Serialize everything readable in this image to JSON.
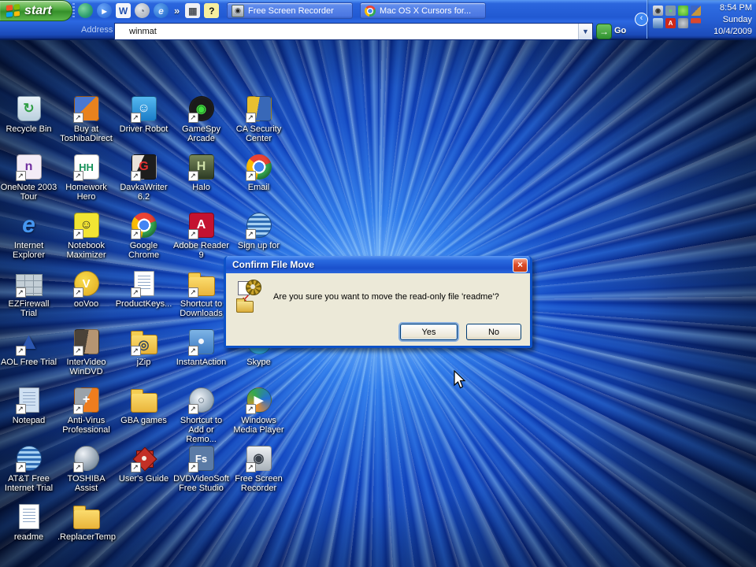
{
  "colors": {
    "taskbar_blue": "#2159d2",
    "taskbar_edge": "#061f5e",
    "start_green": "#358f2a",
    "dialog_bg": "#ece9d8",
    "title_blue": "#1a50cc",
    "close_red": "#dd4b28",
    "folder_yellow": "#f2c94c",
    "label_text": "#ffffff",
    "chrome_ball": [
      "#ea4335",
      "#34a853",
      "#fbbc05",
      "#4285f4"
    ]
  },
  "taskbar": {
    "start": {
      "label": "start"
    },
    "quick_launch": [
      {
        "name": "msn-quicklaunch-icon",
        "shape": "round",
        "glyph": "",
        "fg": "#ffffff",
        "bg": "radial-gradient(circle at 35% 35%, #7ed6a0, #2e9e6e 60%, #1c6e8e)"
      },
      {
        "name": "media-player-quicklaunch-icon",
        "shape": "round",
        "glyph": "▸",
        "fg": "#ffffff",
        "bg": "radial-gradient(circle at 35% 35%, #6aa6f8, #1e5ed0)"
      },
      {
        "name": "word-quicklaunch-icon",
        "shape": "square",
        "glyph": "W",
        "fg": "#1f4fae",
        "bg": "#f4f6fa"
      },
      {
        "name": "quicktime-quicklaunch-icon",
        "shape": "round",
        "glyph": "◔",
        "fg": "#6a7280",
        "bg": "radial-gradient(circle at 35% 35%, #e4e8ee, #9aa2ae)"
      },
      {
        "name": "internet-explorer-quicklaunch-icon",
        "shape": "round",
        "glyph": "e",
        "fg": "#eaf2ff",
        "bg": "radial-gradient(circle at 35% 35%, #63a6f0, #1b62c8)"
      }
    ],
    "overflow_chevron": "»",
    "extra_icons": [
      {
        "name": "keyboard-icon",
        "shape": "square",
        "glyph": "▦",
        "fg": "#4a5058",
        "bg": "#eef0f4"
      },
      {
        "name": "help-icon",
        "shape": "square",
        "glyph": "?",
        "fg": "#111111",
        "bg": "#f7ef9e"
      },
      {
        "name": "desktop-toolbar-icon",
        "shape": "square",
        "glyph": "▣",
        "fg": "#eaf2ff",
        "bg": "transparent"
      },
      {
        "name": "toolbar-dropdown-icon",
        "shape": "square",
        "glyph": "▾",
        "fg": "#eaf2ff",
        "bg": "transparent"
      }
    ],
    "window_buttons": [
      {
        "label": "Free Screen Recorder",
        "icon_name": "camera-icon",
        "icon_class": "cam",
        "icon_glyph": "◉"
      },
      {
        "label": "Mac OS X Cursors for...",
        "icon_name": "chrome-icon",
        "icon_class": "chr",
        "icon_glyph": ""
      }
    ],
    "address": {
      "label": "Address",
      "value": "winmat",
      "dropdown_glyph": "▼",
      "go_label": "Go",
      "go_glyph": "→"
    },
    "tray": {
      "hidden_chevron": "‹",
      "icons": [
        {
          "name": "camera-tray-icon",
          "bg": "linear-gradient(#dfe3e8,#9aa2aa)",
          "glyph": "◉",
          "fg": "#333333"
        },
        {
          "name": "network-monitor-tray-icon",
          "bg": "#7e96ac",
          "glyph": "»",
          "fg": "#58e858"
        },
        {
          "name": "antivirus-shield-tray-icon",
          "bg": "radial-gradient(#9fe35f,#3fae2a)",
          "glyph": "",
          "fg": "#ffffff"
        },
        {
          "name": "security-shield-tray-icon",
          "bg": "linear-gradient(135deg,#3b64c4 50%,#c8963c 50%)",
          "glyph": "",
          "fg": "#ffffff"
        },
        {
          "name": "computer-tray-icon",
          "bg": "linear-gradient(#bcd6f0,#4a7ab8)",
          "glyph": "",
          "fg": "#ffffff"
        },
        {
          "name": "ati-tray-icon",
          "bg": "#d02818",
          "glyph": "A",
          "fg": "#ffffff"
        },
        {
          "name": "volume-tray-icon",
          "bg": "radial-gradient(#c8cdd4,#7e858e)",
          "glyph": "",
          "fg": "#333333"
        },
        {
          "name": "battery-tray-icon",
          "bg": "linear-gradient(#d84830 50%,#2858c0 50%)",
          "glyph": "",
          "fg": "#ffffff"
        }
      ],
      "time": "8:54 PM",
      "day": "Sunday",
      "date": "10/4/2009"
    }
  },
  "dialog": {
    "title": "Confirm File Move",
    "close_glyph": "×",
    "message": "Are you sure you want to move the read-only file 'readme'?",
    "yes_label": "Yes",
    "no_label": "No"
  },
  "desktop": {
    "icons": [
      {
        "label": "Recycle Bin",
        "name": "recycle-bin",
        "type": "bin",
        "bg": "linear-gradient(#eaf3f9,#b9cfdd)",
        "glyph": "↻",
        "fg": "#2f9e44",
        "col": 0,
        "row": 0,
        "shortcut": false
      },
      {
        "label": "Buy at ToshibaDirect",
        "name": "buy-at-toshibadirect",
        "type": "square",
        "bg": "linear-gradient(135deg,#4a78d0 45%,#e8821e 45%)",
        "glyph": "",
        "fg": "#ffffff",
        "col": 1,
        "row": 0,
        "shortcut": true
      },
      {
        "label": "Driver Robot",
        "name": "driver-robot",
        "type": "square",
        "bg": "linear-gradient(#55b8f0,#1a7cc8)",
        "glyph": "☺",
        "fg": "#ffffff",
        "col": 2,
        "row": 0,
        "shortcut": true
      },
      {
        "label": "GameSpy Arcade",
        "name": "gamespy-arcade",
        "type": "circle",
        "bg": "radial-gradient(#1a1a1a 60%,#303030)",
        "glyph": "◉",
        "fg": "#3fe03f",
        "col": 3,
        "row": 0,
        "shortcut": true
      },
      {
        "label": "CA Security Center",
        "name": "ca-security-center",
        "type": "square",
        "bg": "linear-gradient(100deg,#e8c030 45%,#3868b8 45%)",
        "glyph": "",
        "fg": "#ffffff",
        "col": 4,
        "row": 0,
        "shortcut": true
      },
      {
        "label": "OneNote 2003 Tour",
        "name": "onenote-2003-tour",
        "type": "square",
        "bg": "#f3ecf7",
        "glyph": "n",
        "fg": "#7030a0",
        "col": 0,
        "row": 1,
        "shortcut": true
      },
      {
        "label": "Homework Hero",
        "name": "homework-hero",
        "type": "square",
        "bg": "#ffffff",
        "glyph": "HH",
        "fg": "#17925a",
        "col": 1,
        "row": 1,
        "shortcut": true
      },
      {
        "label": "DavkaWriter 6.2",
        "name": "davkawriter-62",
        "type": "square",
        "bg": "linear-gradient(115deg,#e9e2da 35%,#1d1d1d 35%)",
        "glyph": "G",
        "fg": "#e03030",
        "col": 2,
        "row": 1,
        "shortcut": true
      },
      {
        "label": "Halo",
        "name": "halo",
        "type": "square",
        "bg": "linear-gradient(#76875a,#2c3a24)",
        "glyph": "H",
        "fg": "#cfe0a8",
        "col": 3,
        "row": 1,
        "shortcut": true
      },
      {
        "label": "Email",
        "name": "email",
        "type": "chrome",
        "glyph": "",
        "fg": "",
        "col": 4,
        "row": 1,
        "shortcut": true
      },
      {
        "label": "Internet Explorer",
        "name": "internet-explorer",
        "type": "plain",
        "glyph": "e",
        "fg": "#4596f0",
        "col": 0,
        "row": 2,
        "shortcut": false
      },
      {
        "label": "Notebook Maximizer",
        "name": "notebook-maximizer",
        "type": "square",
        "bg": "#f2e533",
        "glyph": "☺",
        "fg": "#222222",
        "col": 1,
        "row": 2,
        "shortcut": true
      },
      {
        "label": "Google Chrome",
        "name": "google-chrome",
        "type": "chrome",
        "glyph": "",
        "fg": "",
        "col": 2,
        "row": 2,
        "shortcut": true
      },
      {
        "label": "Adobe Reader 9",
        "name": "adobe-reader-9",
        "type": "square",
        "bg": "#c41230",
        "glyph": "A",
        "fg": "#ffffff",
        "col": 3,
        "row": 2,
        "shortcut": true
      },
      {
        "label": "Sign up for",
        "name": "sign-up-for",
        "type": "globe",
        "glyph": "",
        "fg": "",
        "col": 4,
        "row": 2,
        "shortcut": true
      },
      {
        "label": "EZFirewall Trial",
        "name": "ezfirewall-trial",
        "type": "wall",
        "glyph": "",
        "fg": "",
        "col": 0,
        "row": 3,
        "shortcut": true
      },
      {
        "label": "ooVoo",
        "name": "oovoo",
        "type": "circle",
        "bg": "radial-gradient(circle at 40% 35%,#f9dc4e,#e0a81c)",
        "glyph": "V",
        "fg": "#ffffff",
        "col": 1,
        "row": 3,
        "shortcut": true
      },
      {
        "label": "ProductKeys...",
        "name": "productkeys",
        "type": "doc",
        "glyph": "",
        "fg": "",
        "col": 2,
        "row": 3,
        "shortcut": true
      },
      {
        "label": "Shortcut to Downloads",
        "name": "shortcut-to-downloads",
        "type": "folder",
        "glyph": "",
        "fg": "",
        "col": 3,
        "row": 3,
        "shortcut": true
      },
      {
        "label": "AOL Free Trial",
        "name": "aol-free-trial",
        "type": "plain",
        "glyph": "▲",
        "fg": "#2b56b0",
        "col": 0,
        "row": 4,
        "shortcut": true
      },
      {
        "label": "InterVideo WinDVD",
        "name": "intervideo-windvd",
        "type": "square",
        "bg": "linear-gradient(100deg,#4a4238 50%,#b59572 50%)",
        "glyph": "",
        "fg": "#ffffff",
        "col": 1,
        "row": 4,
        "shortcut": true
      },
      {
        "label": "jZip",
        "name": "jzip",
        "type": "folder",
        "glyph": "◎",
        "fg": "#35495e",
        "col": 2,
        "row": 4,
        "shortcut": true
      },
      {
        "label": "InstantAction",
        "name": "instantaction",
        "type": "square",
        "bg": "linear-gradient(#7db4e6,#3a78c2)",
        "glyph": "●",
        "fg": "#f2f6fa",
        "col": 3,
        "row": 4,
        "shortcut": true
      },
      {
        "label": "Skype",
        "name": "skype",
        "type": "circle",
        "bg": "radial-gradient(circle at 40% 35%,#62ccf2,#1a96d4)",
        "glyph": "S",
        "fg": "#ffffff",
        "col": 4,
        "row": 4,
        "shortcut": false
      },
      {
        "label": "Notepad",
        "name": "notepad",
        "type": "doc",
        "tint": "#cfe0f2",
        "glyph": "",
        "fg": "",
        "col": 0,
        "row": 5,
        "shortcut": true
      },
      {
        "label": "Anti-Virus Professional",
        "name": "anti-virus-professional",
        "type": "square",
        "bg": "linear-gradient(115deg,#9aa2aa 50%,#ee7d1e 50%)",
        "glyph": "+",
        "fg": "#ffffff",
        "col": 1,
        "row": 5,
        "shortcut": true
      },
      {
        "label": "GBA games",
        "name": "gba-games",
        "type": "folder",
        "glyph": "",
        "fg": "",
        "col": 2,
        "row": 5,
        "shortcut": false
      },
      {
        "label": "Shortcut to Add or Remo...",
        "name": "shortcut-to-add-or-remove",
        "type": "circle",
        "bg": "radial-gradient(circle at 40% 40%,#f2f6fa,#9fb0c0 60%,#6d7f90)",
        "glyph": "○",
        "fg": "#5a6a7a",
        "col": 3,
        "row": 5,
        "shortcut": true
      },
      {
        "label": "Windows Media Player",
        "name": "windows-media-player",
        "type": "circle",
        "bg": "conic-gradient(from 200deg,#f29024,#36a84c,#2470d4,#f29024)",
        "glyph": "▶",
        "fg": "#ffffff",
        "col": 4,
        "row": 5,
        "shortcut": true
      },
      {
        "label": "AT&T Free Internet Trial",
        "name": "att-free-internet-trial",
        "type": "globe",
        "glyph": "",
        "fg": "",
        "col": 0,
        "row": 6,
        "shortcut": true
      },
      {
        "label": "TOSHIBA Assist",
        "name": "toshiba-assist",
        "type": "circle",
        "bg": "radial-gradient(circle at 35% 30%,#eef2f6,#8c9cac 65%,#55697c)",
        "glyph": "",
        "fg": "#ffffff",
        "col": 1,
        "row": 6,
        "shortcut": true
      },
      {
        "label": "User's Guide",
        "name": "users-guide",
        "type": "star",
        "glyph": "",
        "fg": "",
        "col": 2,
        "row": 6,
        "shortcut": true
      },
      {
        "label": "DVDVideoSoft Free Studio",
        "name": "dvdvideosoft-free-studio",
        "type": "square",
        "bg": "#5b7ba6",
        "glyph": "Fs",
        "fg": "#ffffff",
        "col": 3,
        "row": 6,
        "shortcut": true
      },
      {
        "label": "Free Screen Recorder",
        "name": "free-screen-recorder",
        "type": "square",
        "bg": "linear-gradient(#eef1f4,#a9b2ba)",
        "glyph": "◉",
        "fg": "#38404a",
        "col": 4,
        "row": 6,
        "shortcut": true
      },
      {
        "label": "readme",
        "name": "readme",
        "type": "doc",
        "glyph": "",
        "fg": "",
        "col": 0,
        "row": 7,
        "shortcut": false
      },
      {
        "label": ".ReplacerTemp",
        "name": "replacertemp",
        "type": "folder",
        "glyph": "",
        "fg": "",
        "col": 1,
        "row": 7,
        "shortcut": false
      }
    ]
  }
}
